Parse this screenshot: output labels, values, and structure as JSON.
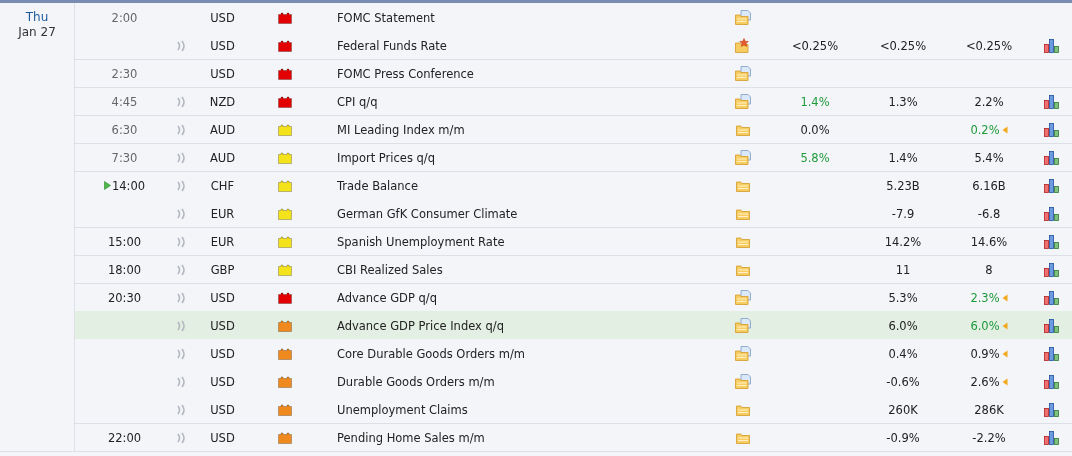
{
  "day": {
    "weekday": "Thu",
    "date": "Jan 27"
  },
  "rows": [
    {
      "time": "2:00",
      "past": true,
      "current": false,
      "sound": false,
      "currency": "USD",
      "color": "#e30000",
      "event": "FOMC Statement",
      "document": true,
      "starred": false,
      "selected": false,
      "chart": false
    },
    {
      "sound": true,
      "currency": "USD",
      "color": "#e30000",
      "event": "Federal Funds Rate",
      "document": false,
      "starred": true,
      "actual": "<0.25%",
      "actual_better": false,
      "forecast": "<0.25%",
      "previous": "<0.25%",
      "previous_better": false,
      "revised": false,
      "selected": false,
      "chart": true
    },
    {
      "time": "2:30",
      "past": true,
      "current": false,
      "sound": false,
      "currency": "USD",
      "color": "#e30000",
      "event": "FOMC Press Conference",
      "document": true,
      "starred": false,
      "selected": false,
      "chart": false
    },
    {
      "time": "4:45",
      "past": true,
      "current": false,
      "sound": true,
      "currency": "NZD",
      "color": "#e30000",
      "event": "CPI q/q",
      "document": true,
      "starred": false,
      "actual": "1.4%",
      "actual_better": true,
      "forecast": "1.3%",
      "previous": "2.2%",
      "previous_better": false,
      "revised": false,
      "selected": false,
      "chart": true
    },
    {
      "time": "6:30",
      "past": true,
      "current": false,
      "sound": true,
      "currency": "AUD",
      "color": "#f4e21a",
      "event": "MI Leading Index m/m",
      "document": false,
      "starred": false,
      "actual": "0.0%",
      "actual_better": false,
      "previous": "0.2%",
      "previous_better": true,
      "revised": true,
      "selected": false,
      "chart": true
    },
    {
      "time": "7:30",
      "past": true,
      "current": false,
      "sound": true,
      "currency": "AUD",
      "color": "#f4e21a",
      "event": "Import Prices q/q",
      "document": true,
      "starred": false,
      "actual": "5.8%",
      "actual_better": true,
      "forecast": "1.4%",
      "previous": "5.4%",
      "previous_better": false,
      "revised": false,
      "selected": false,
      "chart": true
    },
    {
      "time": "14:00",
      "past": false,
      "current": true,
      "sound": true,
      "currency": "CHF",
      "color": "#f4e21a",
      "event": "Trade Balance",
      "document": false,
      "starred": false,
      "forecast": "5.23B",
      "previous": "6.16B",
      "previous_better": false,
      "revised": false,
      "selected": false,
      "chart": true
    },
    {
      "sound": true,
      "currency": "EUR",
      "color": "#f4e21a",
      "event": "German GfK Consumer Climate",
      "document": false,
      "starred": false,
      "forecast": "-7.9",
      "previous": "-6.8",
      "previous_better": false,
      "revised": false,
      "selected": false,
      "chart": true
    },
    {
      "time": "15:00",
      "past": false,
      "current": false,
      "sound": true,
      "currency": "EUR",
      "color": "#f4e21a",
      "event": "Spanish Unemployment Rate",
      "document": false,
      "starred": false,
      "forecast": "14.2%",
      "previous": "14.6%",
      "previous_better": false,
      "revised": false,
      "selected": false,
      "chart": true
    },
    {
      "time": "18:00",
      "past": false,
      "current": false,
      "sound": true,
      "currency": "GBP",
      "color": "#f4e21a",
      "event": "CBI Realized Sales",
      "document": false,
      "starred": false,
      "forecast": "11",
      "previous": "8",
      "previous_better": false,
      "revised": false,
      "selected": false,
      "chart": true
    },
    {
      "time": "20:30",
      "past": false,
      "current": false,
      "sound": true,
      "currency": "USD",
      "color": "#e30000",
      "event": "Advance GDP q/q",
      "document": true,
      "starred": false,
      "forecast": "5.3%",
      "previous": "2.3%",
      "previous_better": true,
      "revised": true,
      "selected": false,
      "chart": true
    },
    {
      "sound": true,
      "currency": "USD",
      "color": "#f18a1e",
      "event": "Advance GDP Price Index q/q",
      "document": true,
      "starred": false,
      "forecast": "6.0%",
      "previous": "6.0%",
      "previous_better": true,
      "revised": true,
      "selected": true,
      "chart": true
    },
    {
      "sound": true,
      "currency": "USD",
      "color": "#f18a1e",
      "event": "Core Durable Goods Orders m/m",
      "document": true,
      "starred": false,
      "forecast": "0.4%",
      "previous": "0.9%",
      "previous_better": false,
      "revised": true,
      "selected": false,
      "chart": true
    },
    {
      "sound": true,
      "currency": "USD",
      "color": "#f18a1e",
      "event": "Durable Goods Orders m/m",
      "document": true,
      "starred": false,
      "forecast": "-0.6%",
      "previous": "2.6%",
      "previous_better": false,
      "revised": true,
      "selected": false,
      "chart": true
    },
    {
      "sound": true,
      "currency": "USD",
      "color": "#f18a1e",
      "event": "Unemployment Claims",
      "document": false,
      "starred": false,
      "forecast": "260K",
      "previous": "286K",
      "previous_better": false,
      "revised": false,
      "selected": false,
      "chart": true
    },
    {
      "time": "22:00",
      "past": false,
      "current": false,
      "sound": true,
      "currency": "USD",
      "color": "#f18a1e",
      "event": "Pending Home Sales m/m",
      "document": false,
      "starred": false,
      "forecast": "-0.9%",
      "previous": "-2.2%",
      "previous_better": false,
      "revised": false,
      "selected": false,
      "chart": true
    }
  ]
}
